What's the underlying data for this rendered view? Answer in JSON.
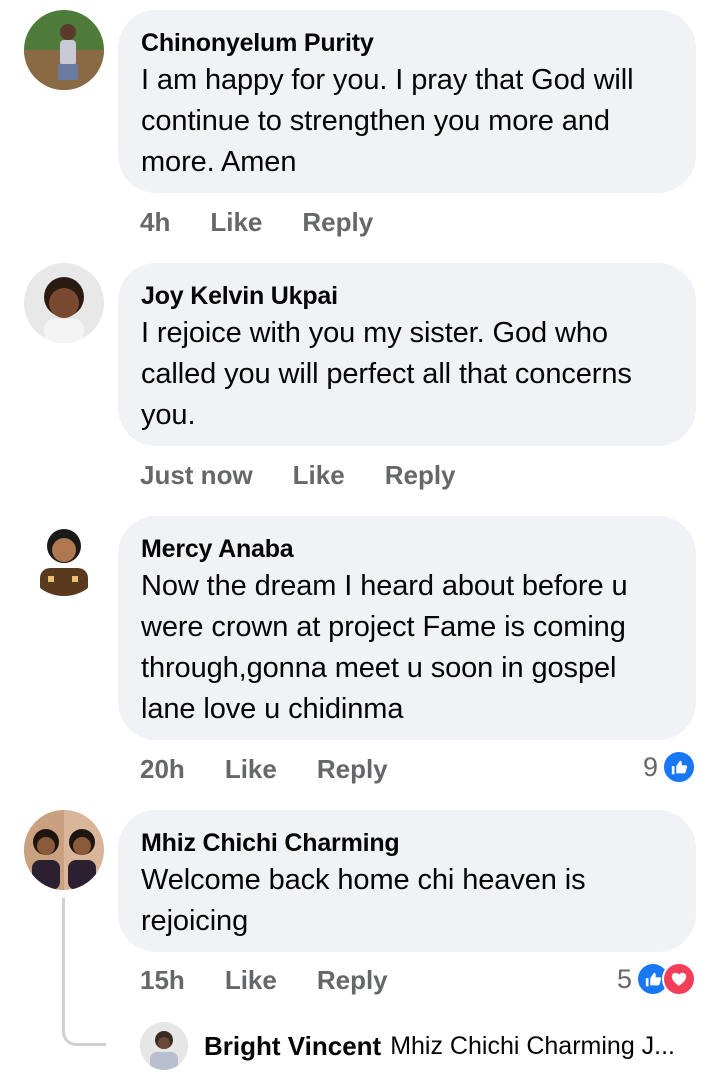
{
  "comments": [
    {
      "author": "Chinonyelum Purity",
      "text": "I am happy for you. I pray that God will continue to  strengthen you more and more. Amen",
      "time": "4h",
      "like_label": "Like",
      "reply_label": "Reply"
    },
    {
      "author": "Joy Kelvin Ukpai",
      "text": "I rejoice with you my sister. God who called you will perfect all that concerns you.",
      "time": "Just now",
      "like_label": "Like",
      "reply_label": "Reply"
    },
    {
      "author": "Mercy Anaba",
      "text": "Now the dream I heard about before u were crown at project Fame is coming through,gonna meet u soon in gospel lane love u chidinma",
      "time": "20h",
      "like_label": "Like",
      "reply_label": "Reply",
      "reaction_count": "9",
      "reactions": [
        "like-icon"
      ]
    },
    {
      "author": "Mhiz Chichi Charming",
      "text": "Welcome back home chi heaven is rejoicing",
      "time": "15h",
      "like_label": "Like",
      "reply_label": "Reply",
      "reaction_count": "5",
      "reactions": [
        "like-icon",
        "love-icon"
      ]
    }
  ],
  "reply_preview": {
    "author": "Bright Vincent",
    "text": "Mhiz Chichi Charming J..."
  },
  "colors": {
    "bubble_bg": "#f0f2f5",
    "meta_text": "#65676b",
    "like_blue": "#1877f2",
    "love_red": "#f33e58"
  }
}
